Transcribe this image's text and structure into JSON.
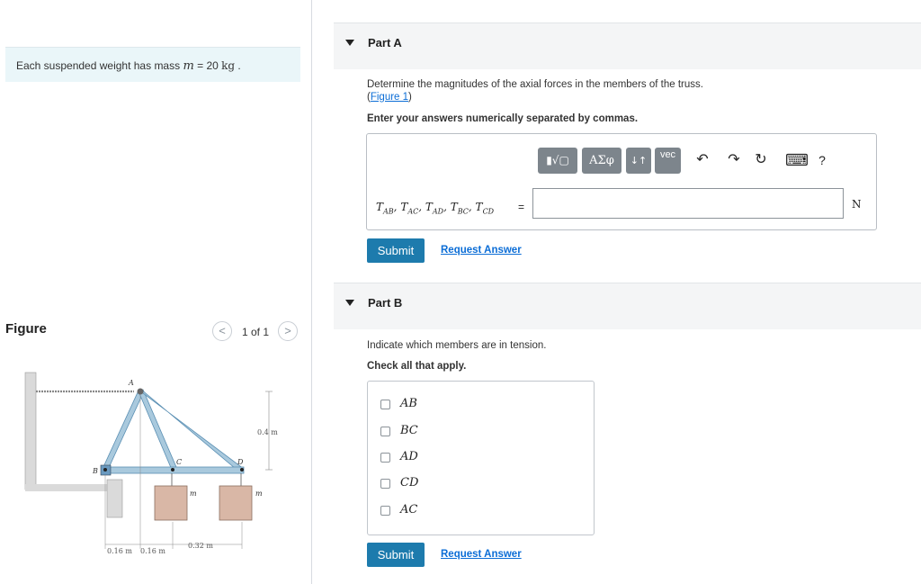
{
  "problem": {
    "prefix": "Each suspended weight has mass ",
    "var": "m",
    "eq": " = 20 ",
    "unit": "kg",
    "suffix": " ."
  },
  "figure": {
    "title": "Figure",
    "prev_icon": "<",
    "next_icon": ">",
    "count": "1 of 1",
    "labels": {
      "A": "A",
      "B": "B",
      "C": "C",
      "D": "D",
      "m1": "m",
      "m2": "m",
      "dim_height": "0.4 m",
      "dim_a": "0.16 m",
      "dim_b": "0.16 m",
      "dim_c": "0.32 m"
    }
  },
  "partA": {
    "label": "Part A",
    "instruction": "Determine the magnitudes of the axial forces in the members of the truss.",
    "figure_link": "Figure 1",
    "note": "Enter your answers numerically separated by commas.",
    "toolbar": {
      "matrix_icon": "▮√▢",
      "greek": "ΑΣφ",
      "arrows": "↓↑",
      "vec": "vec",
      "undo_icon": "↶",
      "redo_icon": "↷",
      "reset_icon": "↻",
      "keyboard_icon": "⌨",
      "help": "?"
    },
    "variables": [
      {
        "t": "T",
        "s": "AB"
      },
      {
        "t": "T",
        "s": "AC"
      },
      {
        "t": "T",
        "s": "AD"
      },
      {
        "t": "T",
        "s": "BC"
      },
      {
        "t": "T",
        "s": "CD"
      }
    ],
    "equals": "=",
    "answer_value": "",
    "unit": "N",
    "submit": "Submit",
    "request": "Request Answer"
  },
  "partB": {
    "label": "Part B",
    "instruction": "Indicate which members are in tension.",
    "note": "Check all that apply.",
    "options": [
      "AB",
      "BC",
      "AD",
      "CD",
      "AC"
    ],
    "submit": "Submit",
    "request": "Request Answer"
  },
  "colors": {
    "accent": "#1d7bad",
    "link": "#0b6dd6",
    "member": "#a9c9dd",
    "weight": "#d9b7a6"
  }
}
